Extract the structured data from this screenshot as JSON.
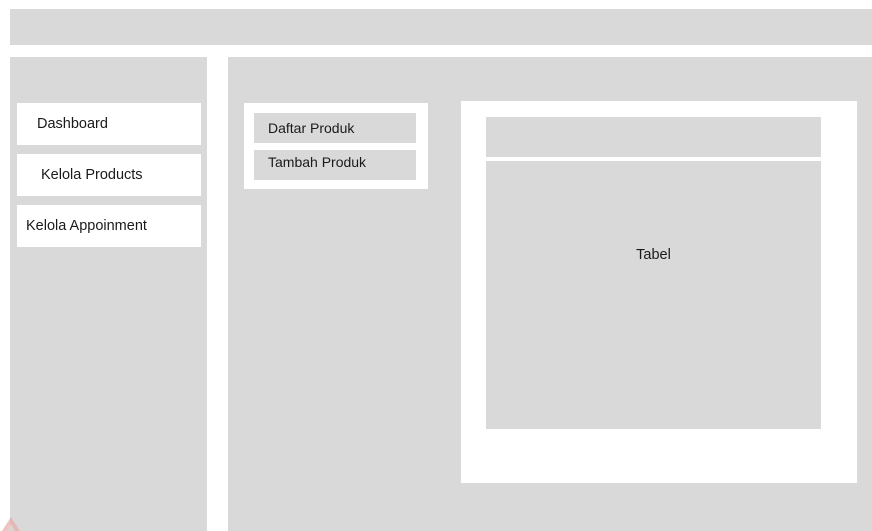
{
  "sidebar": {
    "items": [
      {
        "label": "Dashboard"
      },
      {
        "label": "Kelola Products"
      },
      {
        "label": "Kelola Appoinment"
      }
    ]
  },
  "submenu": {
    "items": [
      {
        "label": "Daftar Produk"
      },
      {
        "label": "Tambah Produk"
      }
    ]
  },
  "content": {
    "table_label": "Tabel"
  },
  "colors": {
    "placeholder_gray": "#d9d9d9",
    "panel_white": "#ffffff"
  }
}
